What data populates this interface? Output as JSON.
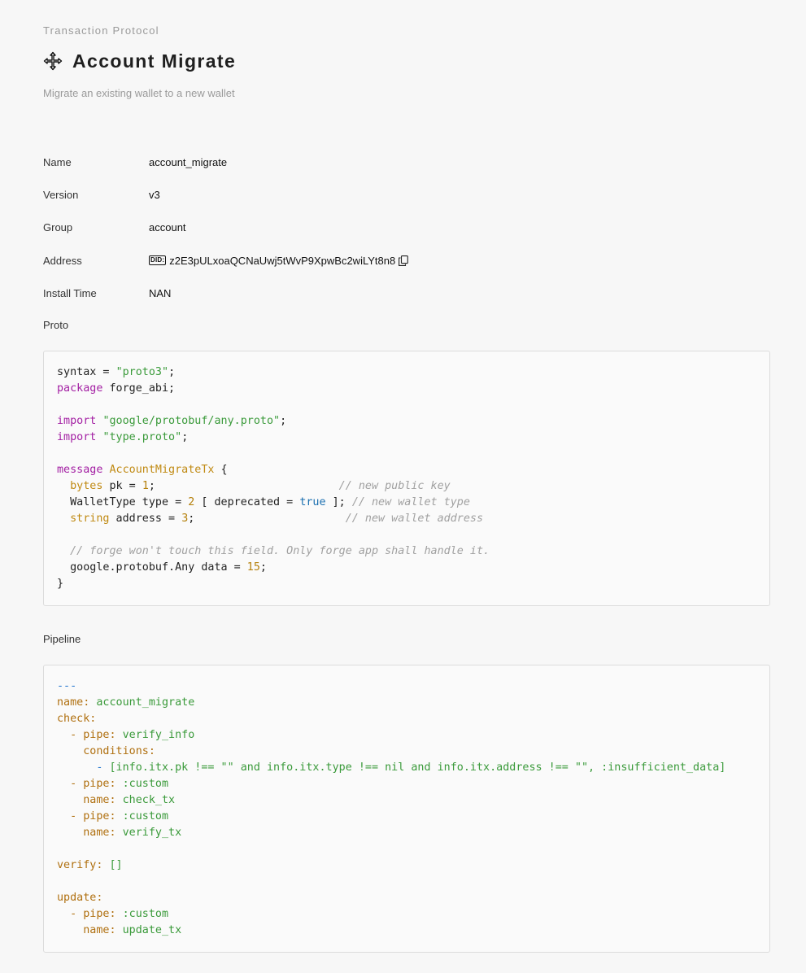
{
  "header": {
    "eyebrow": "Transaction Protocol",
    "title": "Account Migrate",
    "description": "Migrate an existing wallet to a new wallet",
    "icon": "move-arrows-icon"
  },
  "details": {
    "name": {
      "label": "Name",
      "value": "account_migrate"
    },
    "version": {
      "label": "Version",
      "value": "v3"
    },
    "group": {
      "label": "Group",
      "value": "account"
    },
    "address": {
      "label": "Address",
      "badge": "DID:",
      "value": "z2E3pULxoaQCNaUwj5tWvP9XpwBc2wiLYt8n8",
      "icon": "copy-icon"
    },
    "install_time": {
      "label": "Install Time",
      "value": "NAN"
    }
  },
  "proto": {
    "label": "Proto",
    "lines": [
      [
        [
          "t",
          "syntax = "
        ],
        [
          "str",
          "\"proto3\""
        ],
        [
          "t",
          ";"
        ]
      ],
      [
        [
          "kw",
          "package"
        ],
        [
          "t",
          " forge_abi;"
        ]
      ],
      [],
      [
        [
          "kw",
          "import"
        ],
        [
          "t",
          " "
        ],
        [
          "str",
          "\"google/protobuf/any.proto\""
        ],
        [
          "t",
          ";"
        ]
      ],
      [
        [
          "kw",
          "import"
        ],
        [
          "t",
          " "
        ],
        [
          "str",
          "\"type.proto\""
        ],
        [
          "t",
          ";"
        ]
      ],
      [],
      [
        [
          "kw",
          "message"
        ],
        [
          "t",
          " "
        ],
        [
          "cls",
          "AccountMigrateTx"
        ],
        [
          "t",
          " {"
        ]
      ],
      [
        [
          "t",
          "  "
        ],
        [
          "typ",
          "bytes"
        ],
        [
          "t",
          " pk = "
        ],
        [
          "num",
          "1"
        ],
        [
          "t",
          ";                            "
        ],
        [
          "cmt",
          "// new public key"
        ]
      ],
      [
        [
          "t",
          "  WalletType type = "
        ],
        [
          "num",
          "2"
        ],
        [
          "t",
          " [ deprecated = "
        ],
        [
          "bool",
          "true"
        ],
        [
          "t",
          " ]; "
        ],
        [
          "cmt",
          "// new wallet type"
        ]
      ],
      [
        [
          "t",
          "  "
        ],
        [
          "typ",
          "string"
        ],
        [
          "t",
          " address = "
        ],
        [
          "num",
          "3"
        ],
        [
          "t",
          ";                       "
        ],
        [
          "cmt",
          "// new wallet address"
        ]
      ],
      [],
      [
        [
          "t",
          "  "
        ],
        [
          "cmt",
          "// forge won't touch this field. Only forge app shall handle it."
        ]
      ],
      [
        [
          "t",
          "  google.protobuf.Any data = "
        ],
        [
          "num",
          "15"
        ],
        [
          "t",
          ";"
        ]
      ],
      [
        [
          "t",
          "}"
        ]
      ]
    ]
  },
  "pipeline": {
    "label": "Pipeline",
    "lines": [
      [
        [
          "ysep",
          "---"
        ]
      ],
      [
        [
          "ykey",
          "name:"
        ],
        [
          "yval",
          " account_migrate"
        ]
      ],
      [
        [
          "ykey",
          "check:"
        ]
      ],
      [
        [
          "t",
          "  "
        ],
        [
          "ykey",
          "- pipe:"
        ],
        [
          "yval",
          " verify_info"
        ]
      ],
      [
        [
          "t",
          "    "
        ],
        [
          "ykey",
          "conditions:"
        ]
      ],
      [
        [
          "t",
          "      "
        ],
        [
          "ysep",
          "- "
        ],
        [
          "yval",
          "[info.itx.pk !== \"\" and info.itx.type !== nil and info.itx.address !== \"\", :insufficient_data]"
        ]
      ],
      [
        [
          "t",
          "  "
        ],
        [
          "ykey",
          "- pipe:"
        ],
        [
          "yval",
          " :custom"
        ]
      ],
      [
        [
          "t",
          "    "
        ],
        [
          "ykey",
          "name:"
        ],
        [
          "yval",
          " check_tx"
        ]
      ],
      [
        [
          "t",
          "  "
        ],
        [
          "ykey",
          "- pipe:"
        ],
        [
          "yval",
          " :custom"
        ]
      ],
      [
        [
          "t",
          "    "
        ],
        [
          "ykey",
          "name:"
        ],
        [
          "yval",
          " verify_tx"
        ]
      ],
      [],
      [
        [
          "ykey",
          "verify:"
        ],
        [
          "yval",
          " []"
        ]
      ],
      [],
      [
        [
          "ykey",
          "update:"
        ]
      ],
      [
        [
          "t",
          "  "
        ],
        [
          "ykey",
          "- pipe:"
        ],
        [
          "yval",
          " :custom"
        ]
      ],
      [
        [
          "t",
          "    "
        ],
        [
          "ykey",
          "name:"
        ],
        [
          "yval",
          " update_tx"
        ]
      ]
    ]
  }
}
